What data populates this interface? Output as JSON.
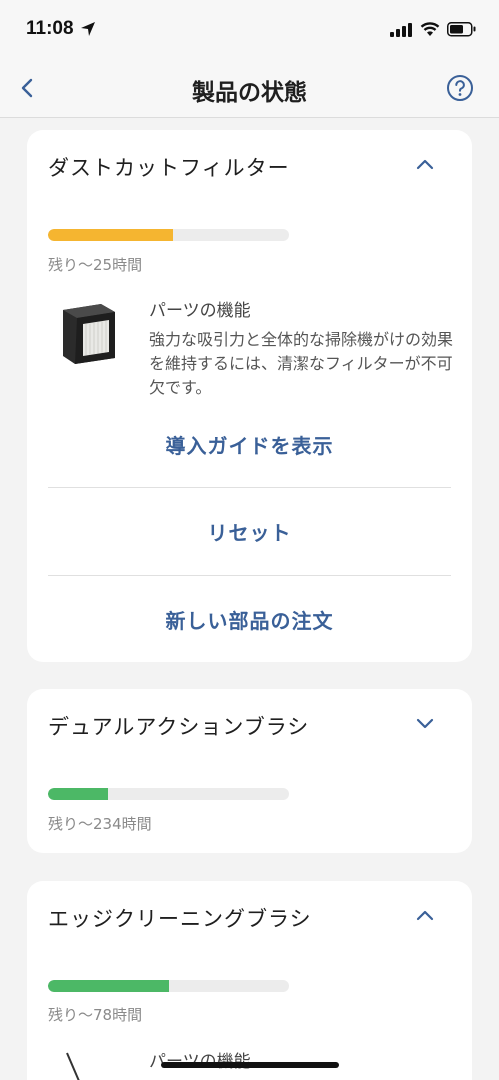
{
  "status_bar": {
    "time": "11:08"
  },
  "nav": {
    "title": "製品の状態"
  },
  "cards": [
    {
      "title": "ダストカットフィルター",
      "expanded": true,
      "progress": 0.52,
      "progress_color": "#f5b530",
      "remaining": "残り〜25時間",
      "part_heading": "パーツの機能",
      "part_description": "強力な吸引力と全体的な掃除機がけの効果を維持するには、清潔なフィルターが不可欠です。",
      "actions": [
        "導入ガイドを表示",
        "リセット",
        "新しい部品の注文"
      ]
    },
    {
      "title": "デュアルアクションブラシ",
      "expanded": false,
      "progress": 0.25,
      "progress_color": "#4cb866",
      "remaining": "残り〜234時間"
    },
    {
      "title": "エッジクリーニングブラシ",
      "expanded": true,
      "progress": 0.5,
      "progress_color": "#4cb866",
      "remaining": "残り〜78時間",
      "part_heading": "パーツの機能"
    }
  ],
  "colors": {
    "accent": "#3a6098",
    "background": "#f3f3f3"
  }
}
